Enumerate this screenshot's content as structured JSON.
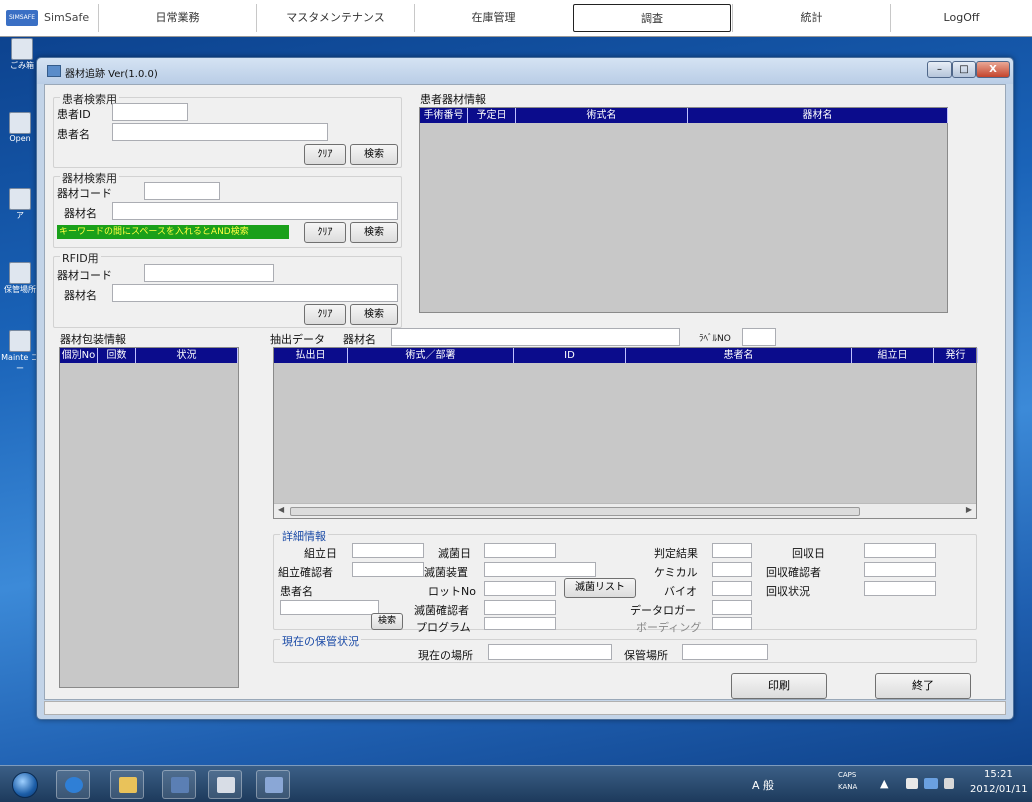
{
  "menubar": {
    "logo": "SIMSAFE",
    "app_name": "SimSafe",
    "items": [
      "日常業務",
      "マスタメンテナンス",
      "在庫管理",
      "調査",
      "統計",
      "LogOff"
    ]
  },
  "desktop": {
    "icons": [
      "ごみ箱",
      "Open",
      "ア",
      "保管場所",
      "Mainte\nコー"
    ]
  },
  "window": {
    "title": "器材追跡 Ver(1.0.0)",
    "controls": {
      "minimize": "–",
      "maximize": "□",
      "close": "X"
    }
  },
  "patient_search": {
    "title": "患者検索用",
    "id_label": "患者ID",
    "id_value": "",
    "name_label": "患者名",
    "name_value": "",
    "clear_label": "ｸﾘｱ",
    "search_label": "検索"
  },
  "equipment_search": {
    "title": "器材検索用",
    "code_label": "器材コード",
    "code_value": "",
    "name_label": "器材名",
    "name_value": "",
    "hint": "キーワードの間にスペースを入れるとAND検索",
    "clear_label": "ｸﾘｱ",
    "search_label": "検索"
  },
  "rfid": {
    "title": "RFID用",
    "code_label": "器材コード",
    "code_value": "",
    "name_label": "器材名",
    "name_value": "",
    "clear_label": "ｸﾘｱ",
    "search_label": "検索"
  },
  "patient_equipment": {
    "title": "患者器材情報",
    "columns": [
      "手術番号",
      "予定日",
      "術式名",
      "器材名"
    ]
  },
  "package_info": {
    "title": "器材包装情報",
    "columns": [
      "個別No",
      "回数",
      "状況"
    ]
  },
  "extract": {
    "label": "抽出データ",
    "name_label": "器材名",
    "name_value": "",
    "label_no_label": "ﾗﾍﾞﾙNO",
    "label_no_value": "",
    "columns": [
      "払出日",
      "術式／部署",
      "ID",
      "患者名",
      "組立日",
      "発行"
    ]
  },
  "detail": {
    "title": "詳細情報",
    "assembly_date": "組立日",
    "assembly_checker": "組立確認者",
    "patient_name": "患者名",
    "search_label": "検索",
    "sterilize_date": "滅菌日",
    "sterilizer": "滅菌装置",
    "lot_no": "ロットNo",
    "sterile_checker": "滅菌確認者",
    "program": "プログラム",
    "sterile_list_btn": "滅菌リスト",
    "judgement": "判定結果",
    "chemical": "ケミカル",
    "bio": "バイオ",
    "datalogger": "データロガー",
    "boarding": "ボーディング",
    "collect_date": "回収日",
    "collect_checker": "回収確認者",
    "collect_status": "回収状況"
  },
  "storage": {
    "title": "現在の保管状況",
    "current_place": "現在の場所",
    "storage_place": "保管場所"
  },
  "actions": {
    "print": "印刷",
    "exit": "終了"
  },
  "taskbar": {
    "ime": "A 般",
    "caps": "CAPS",
    "kana": "KANA",
    "time": "15:21",
    "date": "2012/01/11"
  }
}
